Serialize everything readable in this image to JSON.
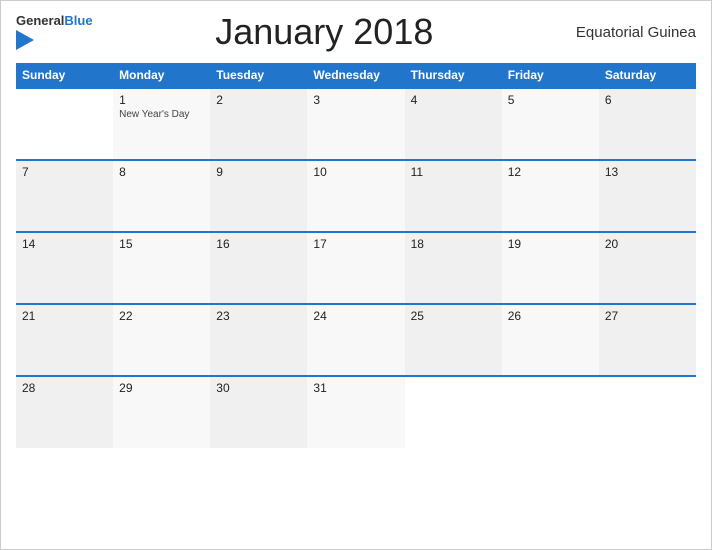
{
  "header": {
    "title": "January 2018",
    "country": "Equatorial Guinea",
    "logo_general": "General",
    "logo_blue": "Blue"
  },
  "days_of_week": [
    "Sunday",
    "Monday",
    "Tuesday",
    "Wednesday",
    "Thursday",
    "Friday",
    "Saturday"
  ],
  "weeks": [
    [
      {
        "day": "",
        "empty": true
      },
      {
        "day": "1",
        "holiday": "New Year's Day"
      },
      {
        "day": "2"
      },
      {
        "day": "3"
      },
      {
        "day": "4"
      },
      {
        "day": "5"
      },
      {
        "day": "6"
      }
    ],
    [
      {
        "day": "7"
      },
      {
        "day": "8"
      },
      {
        "day": "9"
      },
      {
        "day": "10"
      },
      {
        "day": "11"
      },
      {
        "day": "12"
      },
      {
        "day": "13"
      }
    ],
    [
      {
        "day": "14"
      },
      {
        "day": "15"
      },
      {
        "day": "16"
      },
      {
        "day": "17"
      },
      {
        "day": "18"
      },
      {
        "day": "19"
      },
      {
        "day": "20"
      }
    ],
    [
      {
        "day": "21"
      },
      {
        "day": "22"
      },
      {
        "day": "23"
      },
      {
        "day": "24"
      },
      {
        "day": "25"
      },
      {
        "day": "26"
      },
      {
        "day": "27"
      }
    ],
    [
      {
        "day": "28"
      },
      {
        "day": "29"
      },
      {
        "day": "30"
      },
      {
        "day": "31"
      },
      {
        "day": "",
        "empty": true
      },
      {
        "day": "",
        "empty": true
      },
      {
        "day": "",
        "empty": true
      }
    ]
  ]
}
